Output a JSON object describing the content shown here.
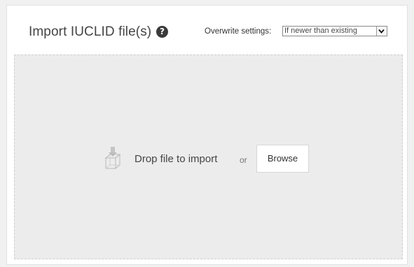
{
  "header": {
    "title": "Import IUCLID file(s)",
    "help_icon": "question-circle-icon",
    "help_glyph": "?",
    "overwrite_label": "Overwrite settings:",
    "overwrite_value": "If newer than existing"
  },
  "dropzone": {
    "icon": "file-drop-icon",
    "drop_text": "Drop file to import",
    "or_text": "or",
    "browse_label": "Browse"
  }
}
